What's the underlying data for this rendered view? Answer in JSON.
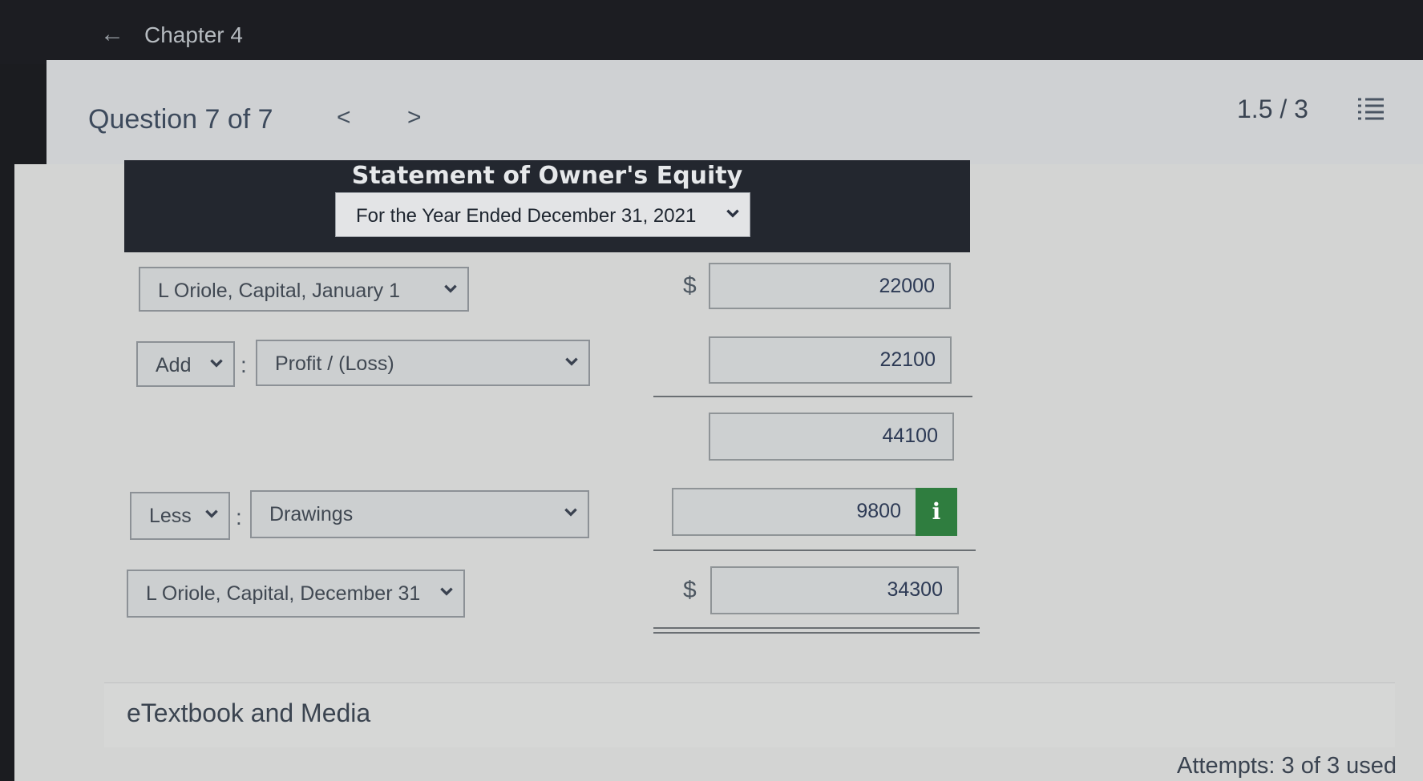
{
  "header": {
    "back_icon": "arrow-left-icon",
    "chapter": "Chapter 4"
  },
  "question_bar": {
    "title": "Question 7 of 7",
    "prev": "<",
    "next": ">",
    "score": "1.5 / 3",
    "menu_icon": "list-icon"
  },
  "statement": {
    "title": "Statement of Owner's Equity",
    "period": "For the Year Ended December 31, 2021",
    "rows": [
      {
        "label": "L Oriole, Capital, January 1",
        "currency": "$",
        "amount": "22000"
      },
      {
        "operator": "Add",
        "label": "Profit / (Loss)",
        "amount": "22100"
      },
      {
        "amount": "44100"
      },
      {
        "operator": "Less",
        "label": "Drawings",
        "amount": "9800",
        "info": "i"
      },
      {
        "label": "L Oriole, Capital, December 31",
        "currency": "$",
        "amount": "34300"
      }
    ]
  },
  "footer": {
    "etextbook": "eTextbook and Media",
    "attempts": "Attempts: 3 of 3 used"
  },
  "colors": {
    "info_button": "#2f7d3f",
    "header_bg": "#23272f"
  }
}
